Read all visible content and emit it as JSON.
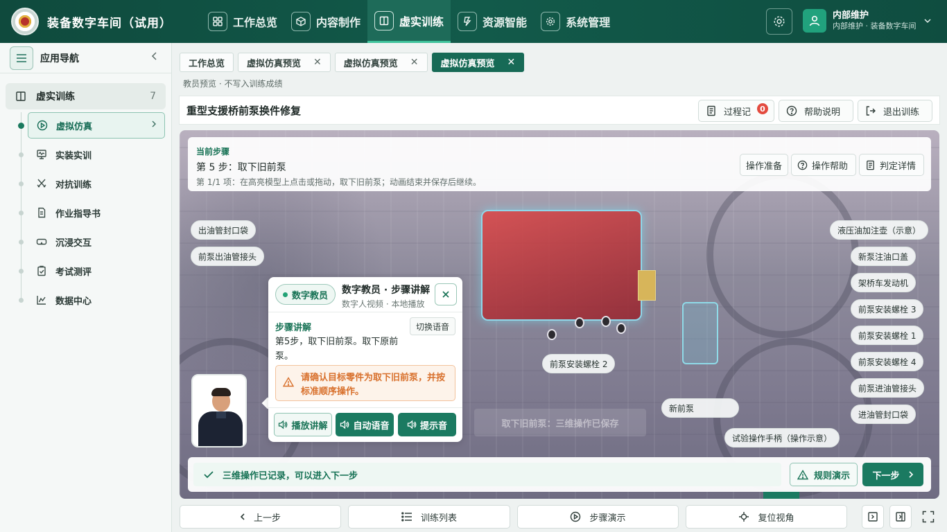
{
  "app": {
    "title": "装备数字车间（试用）"
  },
  "nav": [
    {
      "label": "工作总览",
      "icon": "grid-icon",
      "active": false
    },
    {
      "label": "内容制作",
      "icon": "cube-icon",
      "active": false
    },
    {
      "label": "虚实训练",
      "icon": "book-icon",
      "active": true
    },
    {
      "label": "资源智能",
      "icon": "lightning-icon",
      "active": false
    },
    {
      "label": "系统管理",
      "icon": "gear-icon",
      "active": false
    }
  ],
  "user": {
    "name": "内部维护",
    "subtitle": "内部维护 · 装备数字车间"
  },
  "sidebar": {
    "title": "应用导航",
    "group": {
      "label": "虚实训练",
      "count": "7"
    },
    "items": [
      {
        "label": "虚拟仿真",
        "icon": "play-circle-icon",
        "active": true
      },
      {
        "label": "实装实训",
        "icon": "monitor-icon",
        "active": false
      },
      {
        "label": "对抗训练",
        "icon": "swords-icon",
        "active": false
      },
      {
        "label": "作业指导书",
        "icon": "document-icon",
        "active": false
      },
      {
        "label": "沉浸交互",
        "icon": "vr-glasses-icon",
        "active": false
      },
      {
        "label": "考试测评",
        "icon": "clipboard-icon",
        "active": false
      },
      {
        "label": "数据中心",
        "icon": "chart-icon",
        "active": false
      }
    ]
  },
  "tabs": [
    {
      "label": "工作总览",
      "closable": false,
      "active": false
    },
    {
      "label": "虚拟仿真预览",
      "closable": true,
      "active": false
    },
    {
      "label": "虚拟仿真预览",
      "closable": true,
      "active": false
    },
    {
      "label": "虚拟仿真预览",
      "closable": true,
      "active": true
    }
  ],
  "preview_note": "教员预览 · 不写入训练成绩",
  "header": {
    "title": "重型支援桥前泵换件修复",
    "process_label": "过程记",
    "process_badge": "0",
    "help_label": "帮助说明",
    "exit_label": "退出训练"
  },
  "step": {
    "label": "当前步骤",
    "title": "第 5 步：取下旧前泵",
    "desc": "第 1/1 项：在高亮模型上点击或拖动，取下旧前泵；动画结束并保存后继续。",
    "buttons": {
      "prep": "操作准备",
      "help": "操作帮助",
      "detail": "判定详情"
    }
  },
  "tags": {
    "left": [
      "出油管封口袋",
      "前泵出油管接头"
    ],
    "right": [
      "液压油加注壶（示意）",
      "新泵注油口盖",
      "架桥车发动机",
      "前泵安装螺栓 3",
      "前泵安装螺栓 1",
      "前泵安装螺栓 4",
      "前泵进油管接头",
      "进油管封口袋"
    ],
    "bolt2": "前泵安装螺栓 2",
    "new_pump": "新前泵",
    "handle": "试验操作手柄（操作示意）"
  },
  "scene_hint": "取下旧前泵：三维操作已保存",
  "teacher": {
    "chip": "数字教员",
    "name": "数字教员 · 步骤讲解",
    "sub": "数字人视频 · 本地播放",
    "explain_label": "步骤讲解",
    "switch_voice": "切换语音",
    "explain_text": "第5步，取下旧前泵。取下原前泵。",
    "warning": "请确认目标零件为取下旧前泵，并按标准顺序操作。",
    "btn_play": "播放讲解",
    "btn_auto": "自动语音",
    "btn_tone": "提示音"
  },
  "status": {
    "message": "三维操作已记录，可以进入下一步",
    "rule_demo": "规则演示",
    "next": "下一步"
  },
  "bottom": {
    "prev": "上一步",
    "list": "训练列表",
    "demo": "步骤演示",
    "reset": "复位视角"
  },
  "colors": {
    "primary": "#176a56",
    "accent": "#22a275",
    "warning": "#d8702c",
    "badge": "#e34b3f"
  }
}
